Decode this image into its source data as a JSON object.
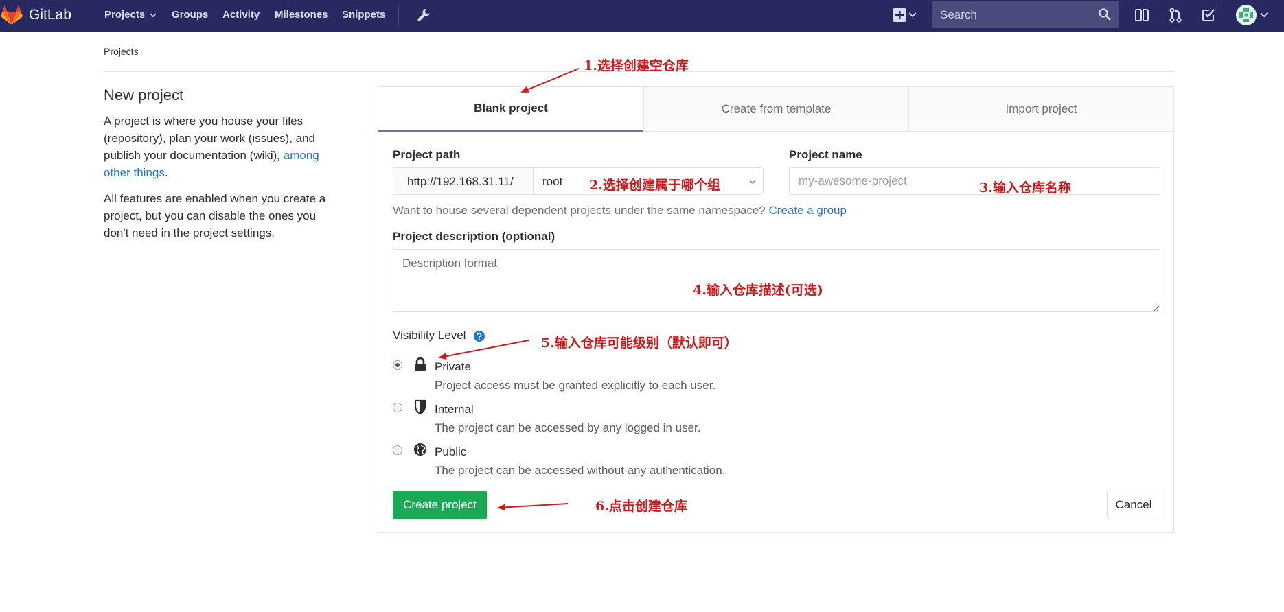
{
  "header": {
    "brand": "GitLab",
    "nav_links": [
      "Projects",
      "Groups",
      "Activity",
      "Milestones",
      "Snippets"
    ],
    "search_placeholder": "Search",
    "colors": {
      "nav_bg": "#292961",
      "brand_orange": "#fc6d26"
    }
  },
  "breadcrumb": "Projects",
  "sidebar": {
    "title": "New project",
    "para1_text": "A project is where you house your files (repository), plan your work (issues), and publish your documentation (wiki),",
    "para1_link": "among other things",
    "para1_end": ".",
    "para2": "All features are enabled when you create a project, but you can disable the ones you don't need in the project settings."
  },
  "tabs": [
    "Blank project",
    "Create from template",
    "Import project"
  ],
  "form": {
    "path_label": "Project path",
    "path_prefix": "http://192.168.31.11/",
    "namespace_value": "root",
    "name_label": "Project name",
    "name_placeholder": "my-awesome-project",
    "help_text": "Want to house several dependent projects under the same namespace?",
    "help_link": "Create a group",
    "desc_label": "Project description (optional)",
    "desc_placeholder": "Description format",
    "visibility_label": "Visibility Level",
    "visibility": [
      {
        "name": "Private",
        "desc": "Project access must be granted explicitly to each user.",
        "icon": "lock-icon",
        "checked": true
      },
      {
        "name": "Internal",
        "desc": "The project can be accessed by any logged in user.",
        "icon": "shield-icon",
        "checked": false
      },
      {
        "name": "Public",
        "desc": "The project can be accessed without any authentication.",
        "icon": "globe-icon",
        "checked": false
      }
    ],
    "create_button": "Create project",
    "cancel_button": "Cancel",
    "colors": {
      "create_green": "#1aaa55",
      "link_blue": "#1f78d1",
      "active_tab_border": "#6e6ea5"
    }
  },
  "annotations": {
    "a1": "1.选择创建空仓库",
    "a2": "2.选择创建属于哪个组",
    "a3": "3.输入仓库名称",
    "a4": "4.输入仓库描述(可选)",
    "a5": "5.输入仓库可能级别（默认即可）",
    "a6": "6.点击创建仓库",
    "color": "#d0191c"
  }
}
